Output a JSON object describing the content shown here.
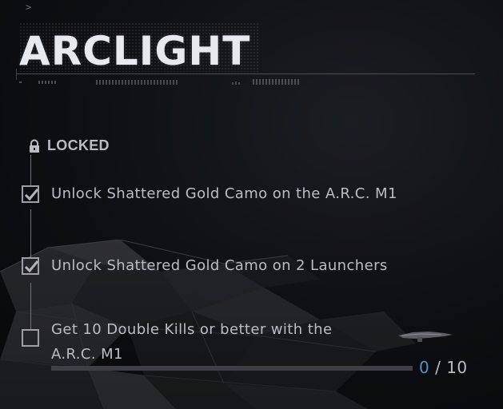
{
  "title": "ARCLIGHT",
  "status": {
    "label": "LOCKED",
    "icon": "lock-icon"
  },
  "challenges": [
    {
      "text": "Unlock Shattered Gold Camo on the A.R.C. M1",
      "completed": true
    },
    {
      "text": "Unlock Shattered Gold Camo on 2 Launchers",
      "completed": true
    },
    {
      "text": "Get 10 Double Kills or better with the A.R.C. M1",
      "completed": false
    }
  ],
  "progress": {
    "current": "0",
    "separator": "/",
    "total": "10",
    "fraction": 0.0
  },
  "colors": {
    "title": "#e6eaee",
    "text": "#b9bec4",
    "accent": "#5b8ec4",
    "track": "#3c4045"
  },
  "corner_mark": ">"
}
